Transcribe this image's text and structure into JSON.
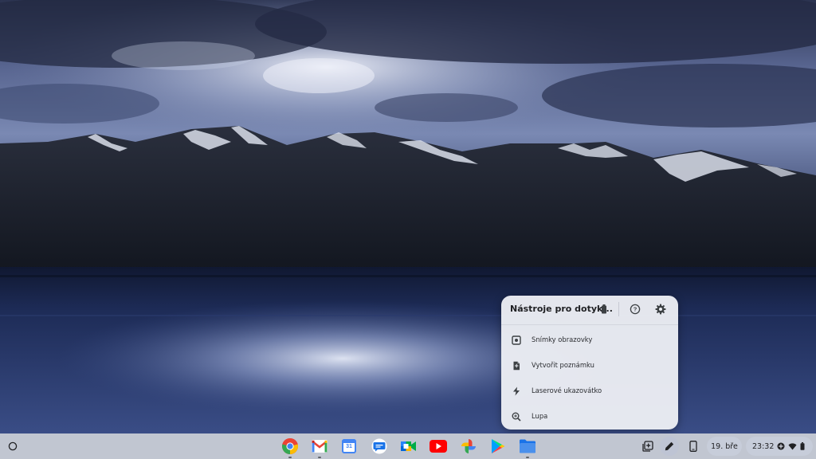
{
  "stylus_menu": {
    "title": "Nástroje pro dotyk...",
    "header_icons": [
      "battery-icon",
      "help-icon",
      "settings-icon"
    ],
    "items": [
      {
        "label": "Snímky obrazovky",
        "icon": "screenshot-icon"
      },
      {
        "label": "Vytvořit poznámku",
        "icon": "note-icon"
      },
      {
        "label": "Laserové ukazovátko",
        "icon": "laser-pointer-icon"
      },
      {
        "label": "Lupa",
        "icon": "magnifier-icon"
      }
    ]
  },
  "shelf": {
    "apps": [
      {
        "name": "Chrome",
        "icon": "chrome-icon"
      },
      {
        "name": "Gmail",
        "icon": "gmail-icon"
      },
      {
        "name": "Calendar",
        "icon": "calendar-icon",
        "text": "31"
      },
      {
        "name": "Messages",
        "icon": "messages-icon"
      },
      {
        "name": "Meet",
        "icon": "meet-icon"
      },
      {
        "name": "YouTube",
        "icon": "youtube-icon"
      },
      {
        "name": "Photos",
        "icon": "photos-icon"
      },
      {
        "name": "Play Store",
        "icon": "play-store-icon"
      },
      {
        "name": "Files",
        "icon": "files-icon"
      }
    ],
    "tray": {
      "date": "19. bře",
      "time": "23:32"
    }
  },
  "colors": {
    "chrome_red": "#ea4335",
    "chrome_yellow": "#fbbc04",
    "chrome_green": "#34a853",
    "google_blue": "#4285f4",
    "youtube_red": "#ff0000",
    "files_blue": "#1a73e8"
  }
}
